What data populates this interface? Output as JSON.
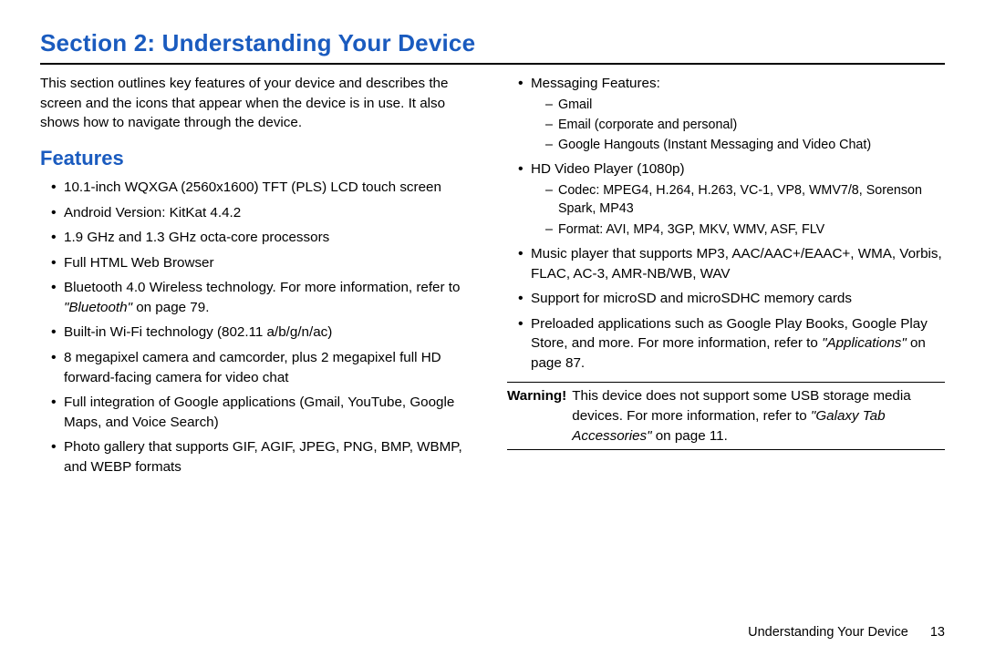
{
  "title": "Section 2: Understanding Your Device",
  "intro": "This section outlines key features of your device and describes the screen and the icons that appear when the device is in use. It also shows how to navigate through the device.",
  "features_heading": "Features",
  "left_bullets": {
    "b0": "10.1-inch WQXGA (2560x1600) TFT (PLS) LCD touch screen",
    "b1": "Android Version: KitKat 4.4.2",
    "b2": "1.9 GHz and 1.3 GHz octa-core processors",
    "b3": "Full HTML Web Browser",
    "b4a": "Bluetooth 4.0 Wireless technology. For more information, refer to ",
    "b4b": "\"Bluetooth\"",
    "b4c": " on page 79.",
    "b5": "Built-in Wi-Fi technology (802.11 a/b/g/n/ac)",
    "b6": "8 megapixel camera and camcorder, plus 2 megapixel full HD forward-facing camera for video chat",
    "b7": "Full integration of Google applications (Gmail, YouTube, Google Maps, and Voice Search)",
    "b8": "Photo gallery that supports GIF, AGIF, JPEG, PNG, BMP, WBMP, and WEBP formats"
  },
  "right_bullets": {
    "msg_label": "Messaging Features:",
    "msg_d0": "Gmail",
    "msg_d1": "Email (corporate and personal)",
    "msg_d2": "Google Hangouts (Instant Messaging and Video Chat)",
    "vid_label": "HD Video Player (1080p)",
    "vid_d0": "Codec: MPEG4, H.264, H.263, VC-1, VP8, WMV7/8, Sorenson Spark, MP43",
    "vid_d1": "Format: AVI, MP4, 3GP, MKV, WMV, ASF, FLV",
    "music": "Music player that supports MP3, AAC/AAC+/EAAC+, WMA, Vorbis, FLAC, AC-3, AMR-NB/WB, WAV",
    "sd": "Support for microSD and microSDHC memory cards",
    "preload_a": "Preloaded applications such as Google Play Books, Google Play Store, and more. For more information, refer to ",
    "preload_b": "\"Applications\"",
    "preload_c": " on page 87."
  },
  "warning": {
    "label": "Warning!",
    "body_a": " This device does not support some USB storage media devices. For more information, refer to ",
    "body_b": "\"Galaxy Tab Accessories\"",
    "body_c": " on page 11."
  },
  "footer": {
    "text": "Understanding Your Device",
    "page": "13"
  }
}
